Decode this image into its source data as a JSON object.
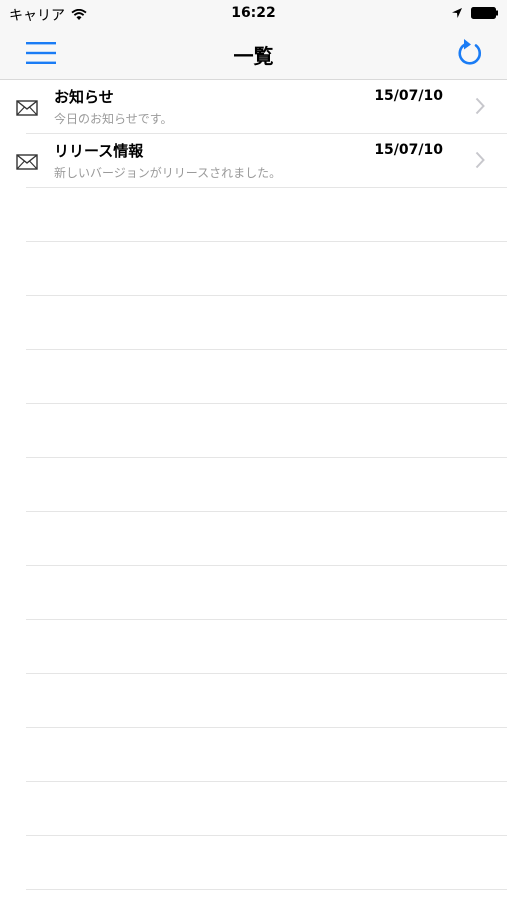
{
  "status_bar": {
    "carrier": "キャリア",
    "time": "16:22",
    "icons": [
      "wifi-icon",
      "location-icon",
      "battery-icon"
    ]
  },
  "nav_bar": {
    "title": "一覧",
    "left_icon": "menu-icon",
    "right_icon": "refresh-icon"
  },
  "colors": {
    "accent": "#1a7cf5",
    "subtitle": "#9a9a9a",
    "separator": "#e5e5e5"
  },
  "list": {
    "items": [
      {
        "icon": "mail-icon",
        "title": "お知らせ",
        "subtitle": "今日のお知らせです。",
        "date": "15/07/10"
      },
      {
        "icon": "mail-icon",
        "title": "リリース情報",
        "subtitle": "新しいバージョンがリリースされました。",
        "date": "15/07/10"
      }
    ]
  }
}
